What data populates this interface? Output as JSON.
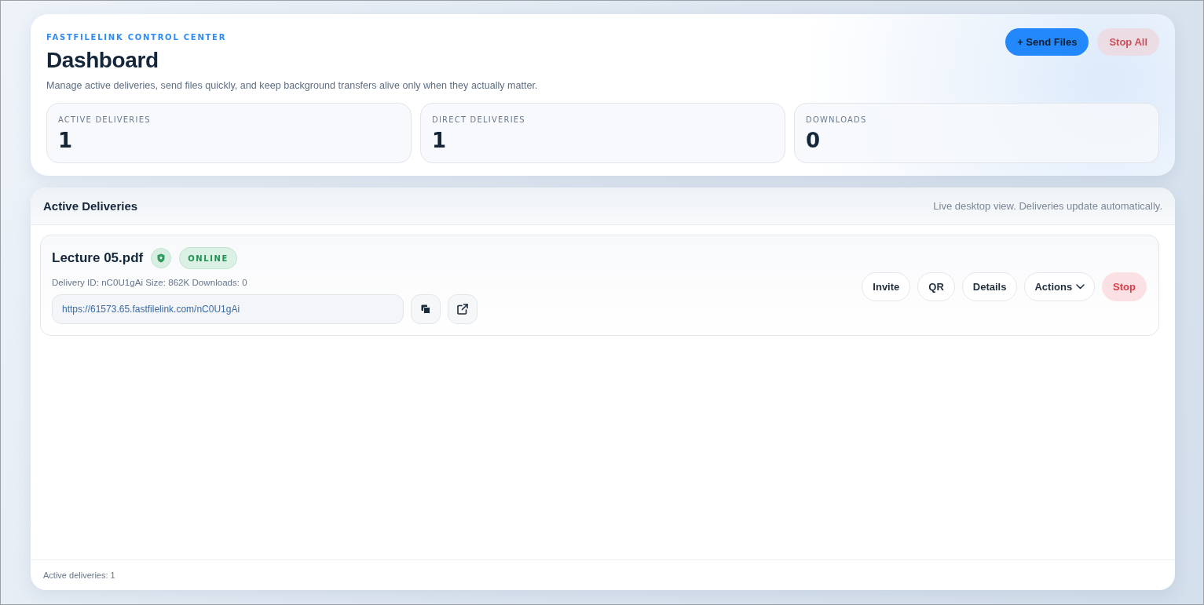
{
  "header": {
    "eyebrow": "FASTFILELINK CONTROL CENTER",
    "title": "Dashboard",
    "subtitle": "Manage active deliveries, send files quickly, and keep background transfers alive only when they actually matter.",
    "actions": [
      {
        "label": "+ Send Files",
        "kind": "primary"
      },
      {
        "label": "Stop All",
        "kind": "danger"
      }
    ]
  },
  "stats": [
    {
      "label": "ACTIVE DELIVERIES",
      "value": "1"
    },
    {
      "label": "DIRECT DELIVERIES",
      "value": "1"
    },
    {
      "label": "DOWNLOADS",
      "value": "0"
    }
  ],
  "deliveries_panel": {
    "title": "Active Deliveries",
    "note": "Live desktop view. Deliveries update automatically.",
    "deliveries": [
      {
        "name": "Lecture 05.pdf",
        "protected": true,
        "status": "ONLINE",
        "meta": "Delivery ID: nC0U1gAi Size: 862K Downloads: 0",
        "url": "https://61573.65.fastfilelink.com/nC0U1gAi",
        "actions": [
          {
            "label": "Invite",
            "kind": "default"
          },
          {
            "label": "QR",
            "kind": "default"
          },
          {
            "label": "Details",
            "kind": "default"
          },
          {
            "label": "Actions",
            "kind": "menu"
          },
          {
            "label": "Stop",
            "kind": "danger"
          }
        ]
      }
    ],
    "footer": "Active deliveries: 1"
  }
}
